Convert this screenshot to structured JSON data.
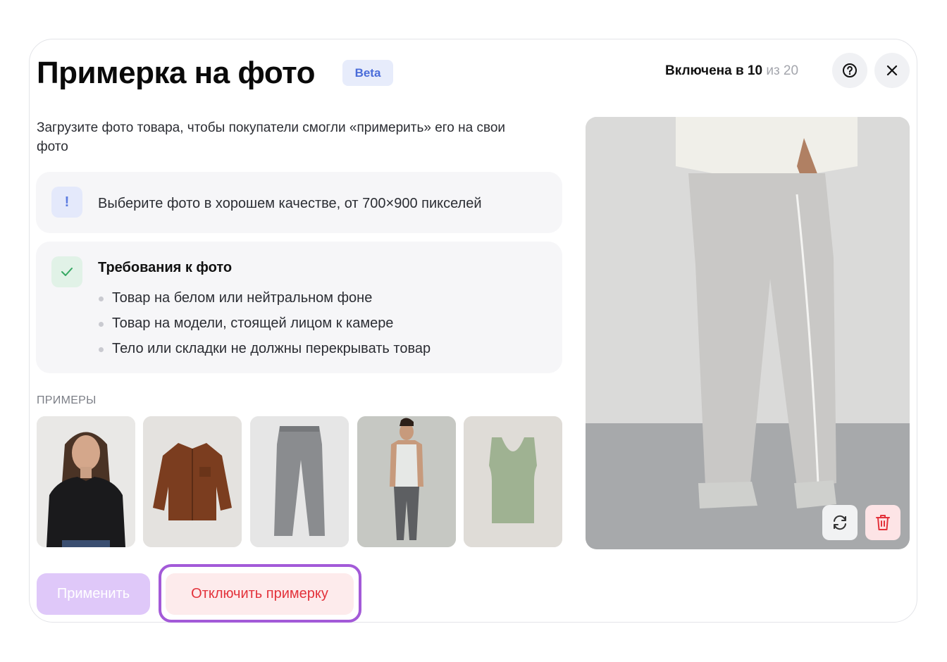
{
  "header": {
    "title": "Примерка на фото",
    "badge": "Beta",
    "usage_prefix": "Включена в 10",
    "usage_suffix": "из 20"
  },
  "subtitle": "Загрузите фото товара, чтобы покупатели смогли «примерить» его на свои фото",
  "notice": {
    "icon_text": "!",
    "text": "Выберите фото в хорошем качестве, от 700×900 пикселей"
  },
  "requirements": {
    "title": "Требования к фото",
    "items": [
      "Товар на белом или нейтральном фоне",
      "Товар на модели, стоящей лицом к камере",
      "Тело или складки не должны перекрывать товар"
    ]
  },
  "examples": {
    "label": "ПРИМЕРЫ",
    "items": [
      {
        "icon": "woman-black-tshirt-photo"
      },
      {
        "icon": "brown-jacket-photo"
      },
      {
        "icon": "grey-jeans-photo"
      },
      {
        "icon": "man-tank-top-photo"
      },
      {
        "icon": "green-top-photo"
      }
    ]
  },
  "actions": {
    "apply": "Применить",
    "disable": "Отключить примерку"
  },
  "icons": {
    "help": "help-icon",
    "close": "close-icon",
    "replace": "refresh-icon",
    "delete": "trash-icon"
  },
  "colors": {
    "accent_purple": "#a35ad8",
    "danger": "#e3323b",
    "beta_bg": "#e7ecfb",
    "beta_text": "#4a6cd9"
  }
}
